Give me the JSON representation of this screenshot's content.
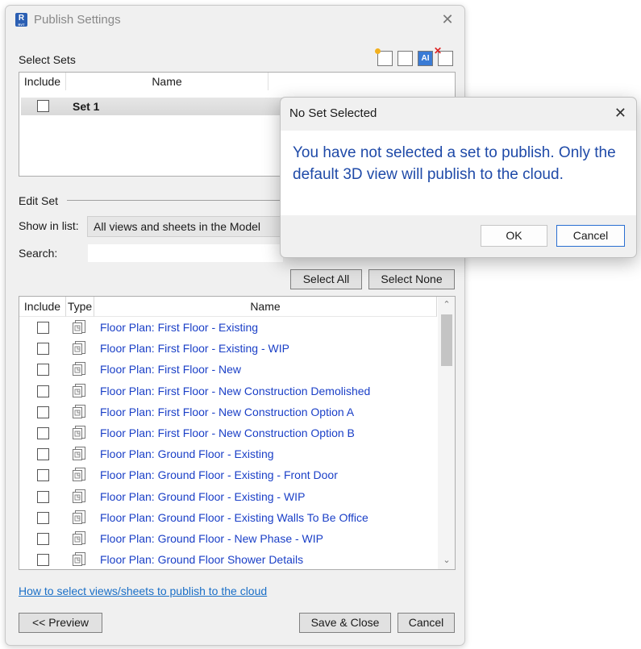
{
  "window": {
    "title": "Publish Settings",
    "app_icon_letter": "R",
    "app_icon_sub": "RVT"
  },
  "select_sets": {
    "label": "Select Sets",
    "headers": {
      "include": "Include",
      "name": "Name"
    },
    "sets": [
      {
        "name": "Set 1",
        "included": false
      }
    ],
    "toolbar_icons": [
      "new-set-icon",
      "duplicate-set-icon",
      "rename-set-icon",
      "delete-set-icon"
    ]
  },
  "edit_set": {
    "label": "Edit Set",
    "show_in_list_label": "Show in list:",
    "show_in_list_value": "All views and sheets in the Model",
    "search_label": "Search:",
    "search_value": "",
    "select_all": "Select All",
    "select_none": "Select None"
  },
  "view_list": {
    "headers": {
      "include": "Include",
      "type": "Type",
      "name": "Name"
    },
    "items": [
      "Floor Plan: First Floor - Existing",
      "Floor Plan: First Floor - Existing - WIP",
      "Floor Plan: First Floor - New",
      "Floor Plan: First Floor - New Construction Demolished",
      "Floor Plan: First Floor - New Construction Option A",
      "Floor Plan: First Floor - New Construction Option B",
      "Floor Plan: Ground Floor - Existing",
      "Floor Plan: Ground Floor - Existing - Front Door",
      "Floor Plan: Ground Floor - Existing - WIP",
      "Floor Plan: Ground Floor - Existing Walls To Be Office",
      "Floor Plan: Ground Floor - New Phase - WIP",
      "Floor Plan: Ground Floor Shower Details"
    ]
  },
  "footer": {
    "help_link": "How to select views/sheets to publish to the cloud",
    "preview": "<< Preview",
    "save_close": "Save & Close",
    "cancel": "Cancel"
  },
  "dialog": {
    "title": "No Set Selected",
    "message": "You have not selected a set to publish. Only the default 3D view will publish to the cloud.",
    "ok": "OK",
    "cancel": "Cancel"
  },
  "colors": {
    "link": "#1a3fc7",
    "message": "#1f4aa8",
    "focus_border": "#2a6fd1"
  }
}
